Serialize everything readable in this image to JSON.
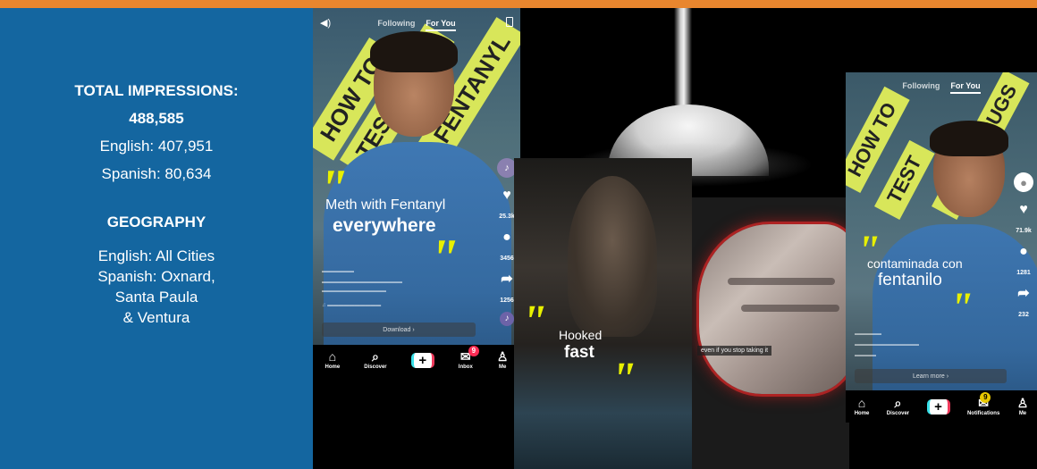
{
  "stats": {
    "total_heading": "TOTAL IMPRESSIONS:",
    "total_value": "488,585",
    "english": "English: 407,951",
    "spanish": "Spanish: 80,634",
    "geo_heading": "GEOGRAPHY",
    "geo_english": "English: All Cities",
    "geo_spanish_1": "Spanish: Oxnard,",
    "geo_spanish_2": "Santa Paula",
    "geo_spanish_3": "& Ventura"
  },
  "phone_left": {
    "tab_following": "Following",
    "tab_for_you": "For You",
    "stripe_1": "HOW TO",
    "stripe_2": "TEST YOUR",
    "stripe_3": "FENTANYL",
    "caption_line_1": "Meth with Fentanyl",
    "caption_line_2": "everywhere",
    "likes": "25.3k",
    "comments": "3456",
    "shares": "1256",
    "cta": "Download",
    "nav": {
      "home": "Home",
      "discover": "Discover",
      "inbox": "Inbox",
      "inbox_badge": "9",
      "me": "Me"
    }
  },
  "card_hooked": {
    "caption_line_1": "Hooked",
    "caption_line_2": "fast"
  },
  "card_hands": {
    "subtitle": "even if you stop taking it"
  },
  "phone_right": {
    "tab_following": "Following",
    "tab_for_you": "For You",
    "stripe_1": "HOW TO",
    "stripe_2": "TEST",
    "stripe_3": "YOUR DRUGS",
    "caption_line_1": "contaminada con",
    "caption_line_2": "fentanilo",
    "likes": "71.9k",
    "comments": "1281",
    "shares": "232",
    "cta": "Learn more",
    "nav": {
      "home": "Home",
      "discover": "Discover",
      "notifications": "Notifications",
      "notifications_badge": "9",
      "me": "Me"
    }
  },
  "colors": {
    "top_bar": "#e9862e",
    "panel": "#1466a0",
    "highlight": "#e8f000",
    "tiktok_red": "#fe2c55"
  }
}
